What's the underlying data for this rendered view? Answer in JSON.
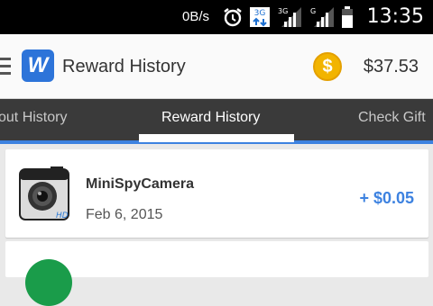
{
  "status_bar": {
    "speed": "0B/s",
    "network_type_1": "3G",
    "network_type_2": "G",
    "time": "13:35"
  },
  "app_bar": {
    "logo_letter": "W",
    "title": "Reward History",
    "coin_symbol": "$",
    "balance": "$37.53"
  },
  "tabs": [
    {
      "label": "Payout History",
      "visible_label": "out History"
    },
    {
      "label": "Reward History",
      "visible_label": "Reward History",
      "active": true
    },
    {
      "label": "Check Gift",
      "visible_label": "Check Gift"
    }
  ],
  "rewards": [
    {
      "name": "MiniSpyCamera",
      "date": "Feb 6, 2015",
      "amount": "+ $0.05",
      "icon": "camera-app-icon"
    },
    {
      "icon": "green-app-icon"
    }
  ],
  "colors": {
    "accent": "#3d82e0",
    "tab_bar": "#3a3a3a",
    "coin": "#f2b400",
    "status_bar": "#000000"
  }
}
